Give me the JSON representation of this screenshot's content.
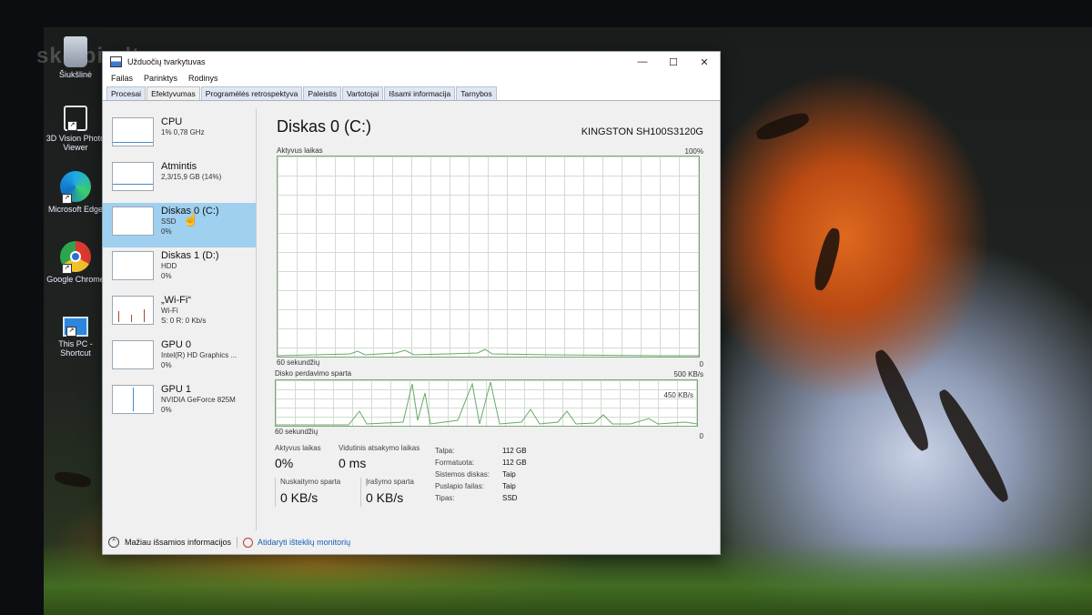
{
  "desktop": {
    "icons": [
      {
        "label": "Šiukšlinė"
      },
      {
        "label": "3D Vision Photo Viewer"
      },
      {
        "label": "Microsoft Edge"
      },
      {
        "label": "Google Chrome"
      },
      {
        "label": "This PC - Shortcut"
      }
    ],
    "watermark": "skelbiu.lt"
  },
  "window": {
    "title": "Užduočių tvarkytuvas",
    "controls": {
      "minimize": "—",
      "maximize": "☐",
      "close": "✕"
    },
    "menu": [
      "Failas",
      "Parinktys",
      "Rodinys"
    ],
    "tabs": [
      {
        "label": "Procesai",
        "active": false
      },
      {
        "label": "Efektyvumas",
        "active": true
      },
      {
        "label": "Programėlės retrospektyva",
        "active": false
      },
      {
        "label": "Paleistis",
        "active": false
      },
      {
        "label": "Vartotojai",
        "active": false
      },
      {
        "label": "Išsami informacija",
        "active": false
      },
      {
        "label": "Tarnybos",
        "active": false
      }
    ]
  },
  "sidebar": {
    "items": [
      {
        "name": "CPU",
        "line1": "1% 0,78 GHz",
        "line2": ""
      },
      {
        "name": "Atmintis",
        "line1": "2,3/15,9 GB (14%)",
        "line2": ""
      },
      {
        "name": "Diskas 0 (C:)",
        "line1": "SSD",
        "line2": "0%"
      },
      {
        "name": "Diskas 1 (D:)",
        "line1": "HDD",
        "line2": "0%"
      },
      {
        "name": "„Wi-Fi“",
        "line1": "Wi-Fi",
        "line2": "S: 0 R: 0 Kb/s"
      },
      {
        "name": "GPU 0",
        "line1": "Intel(R) HD Graphics ...",
        "line2": "0%"
      },
      {
        "name": "GPU 1",
        "line1": "NVIDIA GeForce 825M",
        "line2": "0%"
      }
    ]
  },
  "main": {
    "title": "Diskas 0 (C:)",
    "model": "KINGSTON SH100S3120G",
    "graph1": {
      "label": "Aktyvus laikas",
      "max": "100%",
      "time": "60 sekundžių",
      "min": "0"
    },
    "graph2": {
      "label": "Disko perdavimo sparta",
      "max": "500 KB/s",
      "mid": "450 KB/s",
      "time": "60 sekundžių",
      "min": "0"
    },
    "stats": {
      "active_label": "Aktyvus laikas",
      "active_value": "0%",
      "response_label": "Vidutinis atsakymo laikas",
      "response_value": "0 ms",
      "read_label": "Nuskaitymo sparta",
      "read_value": "0 KB/s",
      "write_label": "Įrašymo sparta",
      "write_value": "0 KB/s"
    },
    "props": [
      {
        "key": "Talpa:",
        "value": "112 GB"
      },
      {
        "key": "Formatuota:",
        "value": "112 GB"
      },
      {
        "key": "Sistemos diskas:",
        "value": "Taip"
      },
      {
        "key": "Puslapio failas:",
        "value": "Taip"
      },
      {
        "key": "Tipas:",
        "value": "SSD"
      }
    ]
  },
  "footer": {
    "less_details": "Mažiau išsamios informacijos",
    "resource_monitor": "Atidaryti išteklių monitorių"
  }
}
